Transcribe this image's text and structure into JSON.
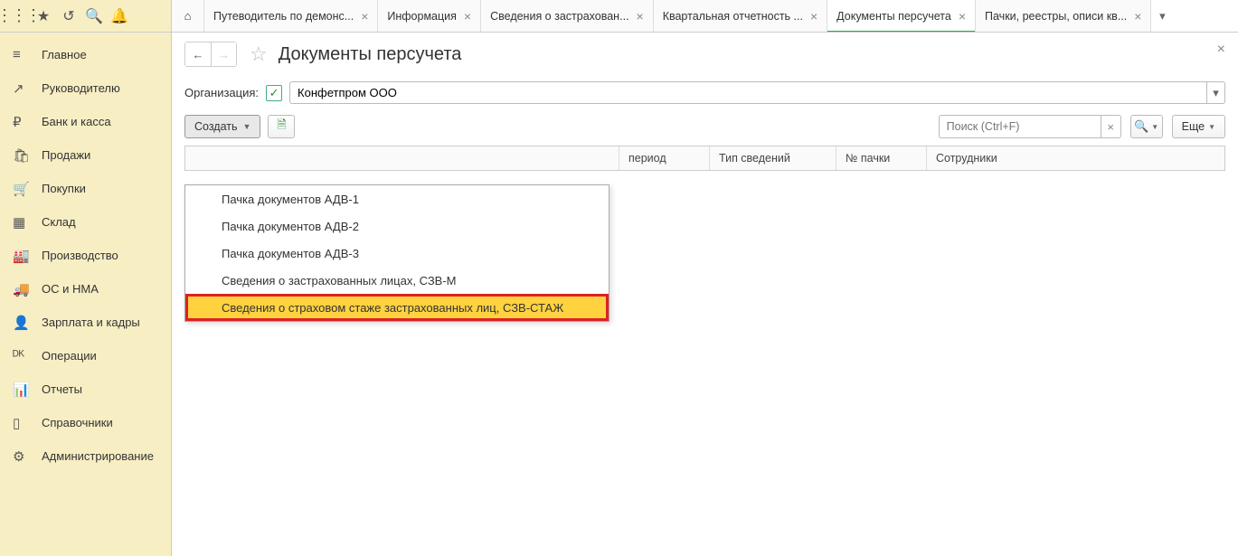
{
  "tabs": [
    {
      "label": "Путеводитель по демонс..."
    },
    {
      "label": "Информация"
    },
    {
      "label": "Сведения о застрахован..."
    },
    {
      "label": "Квартальная отчетность ..."
    },
    {
      "label": "Документы персучета",
      "active": true
    },
    {
      "label": "Пачки, реестры, описи кв..."
    }
  ],
  "sidebar": [
    {
      "icon": "≡",
      "label": "Главное"
    },
    {
      "icon": "↗",
      "label": "Руководителю"
    },
    {
      "icon": "₽",
      "label": "Банк и касса"
    },
    {
      "icon": "🛍",
      "label": "Продажи"
    },
    {
      "icon": "🛒",
      "label": "Покупки"
    },
    {
      "icon": "▦",
      "label": "Склад"
    },
    {
      "icon": "🏭",
      "label": "Производство"
    },
    {
      "icon": "🚚",
      "label": "ОС и НМА"
    },
    {
      "icon": "👤",
      "label": "Зарплата и кадры"
    },
    {
      "icon": "ᴰᴷ",
      "label": "Операции"
    },
    {
      "icon": "📊",
      "label": "Отчеты"
    },
    {
      "icon": "▯",
      "label": "Справочники"
    },
    {
      "icon": "⚙",
      "label": "Администрирование"
    }
  ],
  "page_title": "Документы персучета",
  "filter": {
    "label": "Организация:",
    "value": "Конфетпром ООО"
  },
  "toolbar": {
    "create": "Создать",
    "search_placeholder": "Поиск (Ctrl+F)",
    "more": "Еще"
  },
  "columns": {
    "period": "период",
    "type": "Тип сведений",
    "packno": "№ пачки",
    "employees": "Сотрудники"
  },
  "dropdown_items": [
    "Пачка документов АДВ-1",
    "Пачка документов АДВ-2",
    "Пачка документов АДВ-3",
    "Сведения о застрахованных лицах, СЗВ-М",
    "Сведения о страховом стаже застрахованных лиц, СЗВ-СТАЖ"
  ]
}
